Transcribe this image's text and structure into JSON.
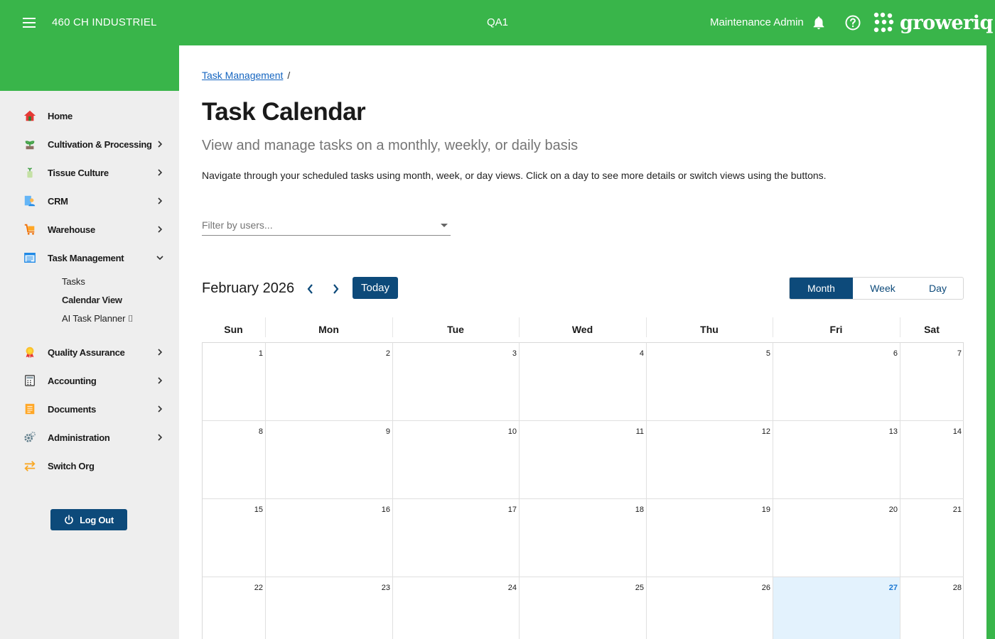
{
  "header": {
    "org_name": "460 CH INDUSTRIEL",
    "environment": "QA1",
    "user_name": "Maintenance Admin",
    "logo_text": "groweriq",
    "menu_icon": "hamburger-menu-icon",
    "bell_icon": "bell-icon",
    "help_icon": "help-circle-icon",
    "brand_color": "#39b54a"
  },
  "sidebar": {
    "items": [
      {
        "label": "Home",
        "icon": "home-icon"
      },
      {
        "label": "Cultivation & Processing",
        "icon": "plant-icon"
      },
      {
        "label": "Tissue Culture",
        "icon": "tissue-culture-icon"
      },
      {
        "label": "CRM",
        "icon": "crm-icon"
      },
      {
        "label": "Warehouse",
        "icon": "warehouse-cart-icon"
      },
      {
        "label": "Task Management",
        "icon": "task-list-icon"
      },
      {
        "label": "Quality Assurance",
        "icon": "medal-icon"
      },
      {
        "label": "Accounting",
        "icon": "calculator-icon"
      },
      {
        "label": "Documents",
        "icon": "document-icon"
      },
      {
        "label": "Administration",
        "icon": "gear-icon"
      },
      {
        "label": "Switch Org",
        "icon": "switch-arrows-icon"
      }
    ],
    "task_sub_items": [
      {
        "label": "Tasks"
      },
      {
        "label": "Calendar View"
      },
      {
        "label": "AI Task Planner ⌷"
      }
    ],
    "logout_label": "Log Out"
  },
  "breadcrumb": {
    "link": "Task Management",
    "separator": "/"
  },
  "page": {
    "title": "Task Calendar",
    "subtitle": "View and manage tasks on a monthly, weekly, or daily basis",
    "description": "Navigate through your scheduled tasks using month, week, or day views. Click on a day to see more details or switch views using the buttons."
  },
  "filter": {
    "placeholder": "Filter by users..."
  },
  "calendar": {
    "month_label": "February 2026",
    "today_label": "Today",
    "views": [
      "Month",
      "Week",
      "Day"
    ],
    "active_view": "Month",
    "weekdays": [
      "Sun",
      "Mon",
      "Tue",
      "Wed",
      "Thu",
      "Fri",
      "Sat"
    ],
    "weeks": [
      [
        "1",
        "2",
        "3",
        "4",
        "5",
        "6",
        "7"
      ],
      [
        "8",
        "9",
        "10",
        "11",
        "12",
        "13",
        "14"
      ],
      [
        "15",
        "16",
        "17",
        "18",
        "19",
        "20",
        "21"
      ],
      [
        "22",
        "23",
        "24",
        "25",
        "26",
        "27",
        "28"
      ]
    ],
    "today": "27",
    "accent_color": "#0d4a7a",
    "today_bg": "#e3f2fd"
  }
}
